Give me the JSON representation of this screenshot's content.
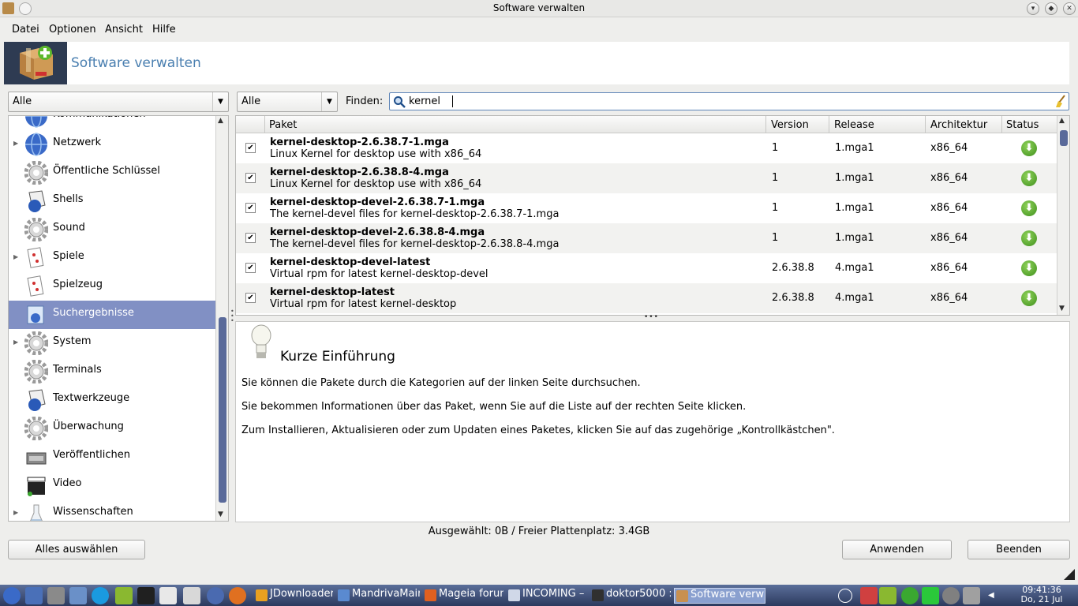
{
  "window": {
    "title": "Software verwalten"
  },
  "menu": {
    "datei": "Datei",
    "optionen": "Optionen",
    "ansicht": "Ansicht",
    "hilfe": "Hilfe"
  },
  "banner": {
    "title": "Software verwalten"
  },
  "filters": {
    "left_combo": "Alle",
    "type_combo": "Alle",
    "find_label": "Finden:",
    "search_value": "kernel"
  },
  "categories": [
    {
      "label": "Kommunikationen",
      "icon": "globe-icon",
      "expandable": false
    },
    {
      "label": "Netzwerk",
      "icon": "globe-icon",
      "expandable": true
    },
    {
      "label": "Öffentliche Schlüssel",
      "icon": "gear-icon",
      "expandable": false
    },
    {
      "label": "Shells",
      "icon": "shell-icon",
      "expandable": false
    },
    {
      "label": "Sound",
      "icon": "gear-icon",
      "expandable": false
    },
    {
      "label": "Spiele",
      "icon": "cards-icon",
      "expandable": true
    },
    {
      "label": "Spielzeug",
      "icon": "cards-icon",
      "expandable": false
    },
    {
      "label": "Suchergebnisse",
      "icon": "search-results-icon",
      "expandable": false,
      "selected": true
    },
    {
      "label": "System",
      "icon": "gear-icon",
      "expandable": true
    },
    {
      "label": "Terminals",
      "icon": "gear-icon",
      "expandable": false
    },
    {
      "label": "Textwerkzeuge",
      "icon": "shell-icon",
      "expandable": false
    },
    {
      "label": "Überwachung",
      "icon": "gear-icon",
      "expandable": false
    },
    {
      "label": "Veröffentlichen",
      "icon": "typewriter-icon",
      "expandable": false
    },
    {
      "label": "Video",
      "icon": "clapper-icon",
      "expandable": false
    },
    {
      "label": "Wissenschaften",
      "icon": "flask-icon",
      "expandable": true
    }
  ],
  "table": {
    "headers": {
      "paket": "Paket",
      "version": "Version",
      "release": "Release",
      "arch": "Architektur",
      "status": "Status"
    },
    "rows": [
      {
        "name": "kernel-desktop-2.6.38.7-1.mga",
        "desc": "Linux Kernel for desktop use with x86_64",
        "version": "1",
        "release": "1.mga1",
        "arch": "x86_64",
        "checked": "✔"
      },
      {
        "name": "kernel-desktop-2.6.38.8-4.mga",
        "desc": "Linux Kernel for desktop use with x86_64",
        "version": "1",
        "release": "1.mga1",
        "arch": "x86_64",
        "checked": "✔"
      },
      {
        "name": "kernel-desktop-devel-2.6.38.7-1.mga",
        "desc": "The kernel-devel files for kernel-desktop-2.6.38.7-1.mga",
        "version": "1",
        "release": "1.mga1",
        "arch": "x86_64",
        "checked": "✔"
      },
      {
        "name": "kernel-desktop-devel-2.6.38.8-4.mga",
        "desc": "The kernel-devel files for kernel-desktop-2.6.38.8-4.mga",
        "version": "1",
        "release": "1.mga1",
        "arch": "x86_64",
        "checked": "✔"
      },
      {
        "name": "kernel-desktop-devel-latest",
        "desc": "Virtual rpm for latest kernel-desktop-devel",
        "version": "2.6.38.8",
        "release": "4.mga1",
        "arch": "x86_64",
        "checked": "✔"
      },
      {
        "name": "kernel-desktop-latest",
        "desc": "Virtual rpm for latest kernel-desktop",
        "version": "2.6.38.8",
        "release": "4.mga1",
        "arch": "x86_64",
        "checked": "✔"
      }
    ]
  },
  "info": {
    "title": "Kurze Einführung",
    "p1": "Sie können die Pakete durch die Kategorien auf der linken Seite durchsuchen.",
    "p2": "Sie bekommen Informationen über das Paket, wenn Sie auf die Liste auf der rechten Seite klicken.",
    "p3": "Zum Installieren, Aktualisieren oder zum Updaten eines Paketes, klicken Sie auf das zugehörige „Kontrollkästchen\"."
  },
  "status": {
    "text": "Ausgewählt: 0B / Freier Plattenplatz: 3.4GB"
  },
  "buttons": {
    "select_all": "Alles auswählen",
    "apply": "Anwenden",
    "quit": "Beenden"
  },
  "taskbar": {
    "tasks": [
      {
        "label": "JDownloader",
        "color": "#e8a020"
      },
      {
        "label": "MandrivaMain",
        "color": "#5a8ad0"
      },
      {
        "label": "Mageia forum",
        "color": "#e06020"
      },
      {
        "label": "INCOMING – D",
        "color": "#d0d8e8"
      },
      {
        "label": "doktor5000 :",
        "color": "#303030"
      },
      {
        "label": "Software verw",
        "color": "#c89050"
      }
    ],
    "clock_time": "09:41:36",
    "clock_date": "Do, 21 Jul"
  },
  "colors": {
    "selection": "#8190c4",
    "banner_title": "#4a7fb0",
    "status_green": "#4caf28"
  }
}
